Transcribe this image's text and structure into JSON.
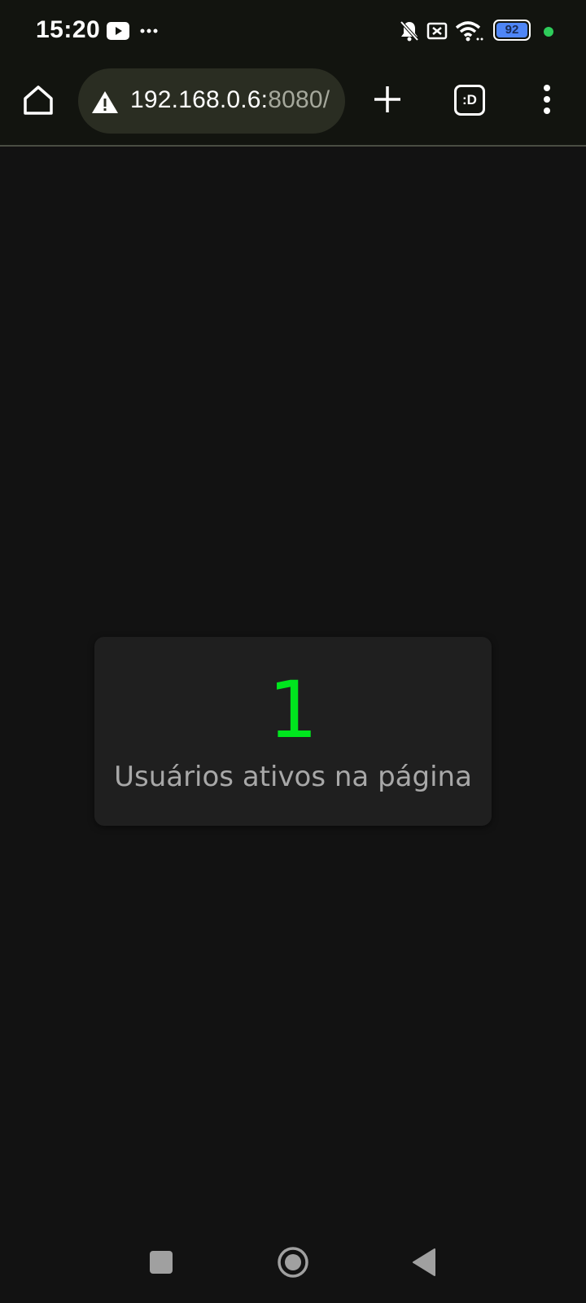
{
  "status_bar": {
    "time": "15:20",
    "battery_level": "92",
    "icons": [
      "youtube-icon",
      "more-dots-icon",
      "bell-off-icon",
      "sim-x-icon",
      "wifi-icon",
      "battery-icon",
      "privacy-dot"
    ]
  },
  "toolbar": {
    "url_host": "192.168.0.6:",
    "url_port": "8080/",
    "tabs_label": ":D",
    "icons": [
      "home-icon",
      "warning-icon",
      "plus-icon",
      "tabs-icon",
      "menu-dots-icon"
    ]
  },
  "main": {
    "count": "1",
    "count_label": "Usuários ativos na página",
    "count_color": "#00e51e"
  },
  "nav_bar": {
    "icons": [
      "recents-icon",
      "home-circle-icon",
      "back-triangle-icon"
    ]
  },
  "colors": {
    "background": "#121212",
    "card": "#1f1f1f",
    "toolbar": "#12140f",
    "url_pill": "#2a2d22"
  }
}
